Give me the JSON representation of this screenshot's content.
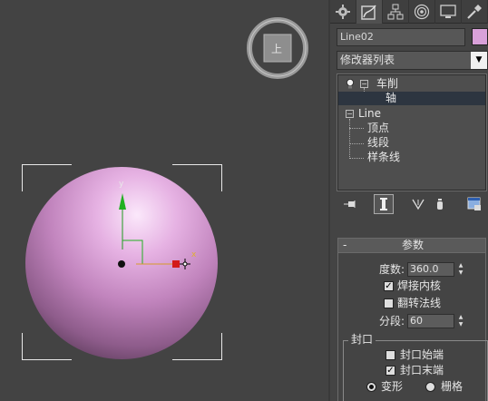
{
  "viewport": {
    "viewcube_face": "上",
    "axis_y": "y",
    "axis_x": "x",
    "object_color": "#d9a1d9"
  },
  "panel": {
    "tabs": [
      {
        "icon": "create-icon"
      },
      {
        "icon": "modify-icon"
      },
      {
        "icon": "hierarchy-icon"
      },
      {
        "icon": "motion-icon"
      },
      {
        "icon": "display-icon"
      },
      {
        "icon": "utilities-icon"
      }
    ],
    "object_name": "Line02",
    "object_color": "#d9a1d9",
    "modifier_list": "修改器列表",
    "stack": {
      "lathe": "车削",
      "axis": "轴",
      "line": "Line",
      "vertex": "顶点",
      "segment": "线段",
      "spline": "样条线"
    },
    "parameters": {
      "header": "参数",
      "degrees_label": "度数:",
      "degrees_value": "360.0",
      "weld_core": "焊接内核",
      "weld_core_checked": true,
      "flip_normals": "翻转法线",
      "flip_normals_checked": false,
      "segments_label": "分段:",
      "segments_value": "60",
      "capping_group": "封口",
      "cap_start": "封口始端",
      "cap_start_checked": false,
      "cap_end": "封口末端",
      "cap_end_checked": true,
      "morph": "变形",
      "grid": "栅格",
      "selected_cap_mode": "变形"
    }
  }
}
